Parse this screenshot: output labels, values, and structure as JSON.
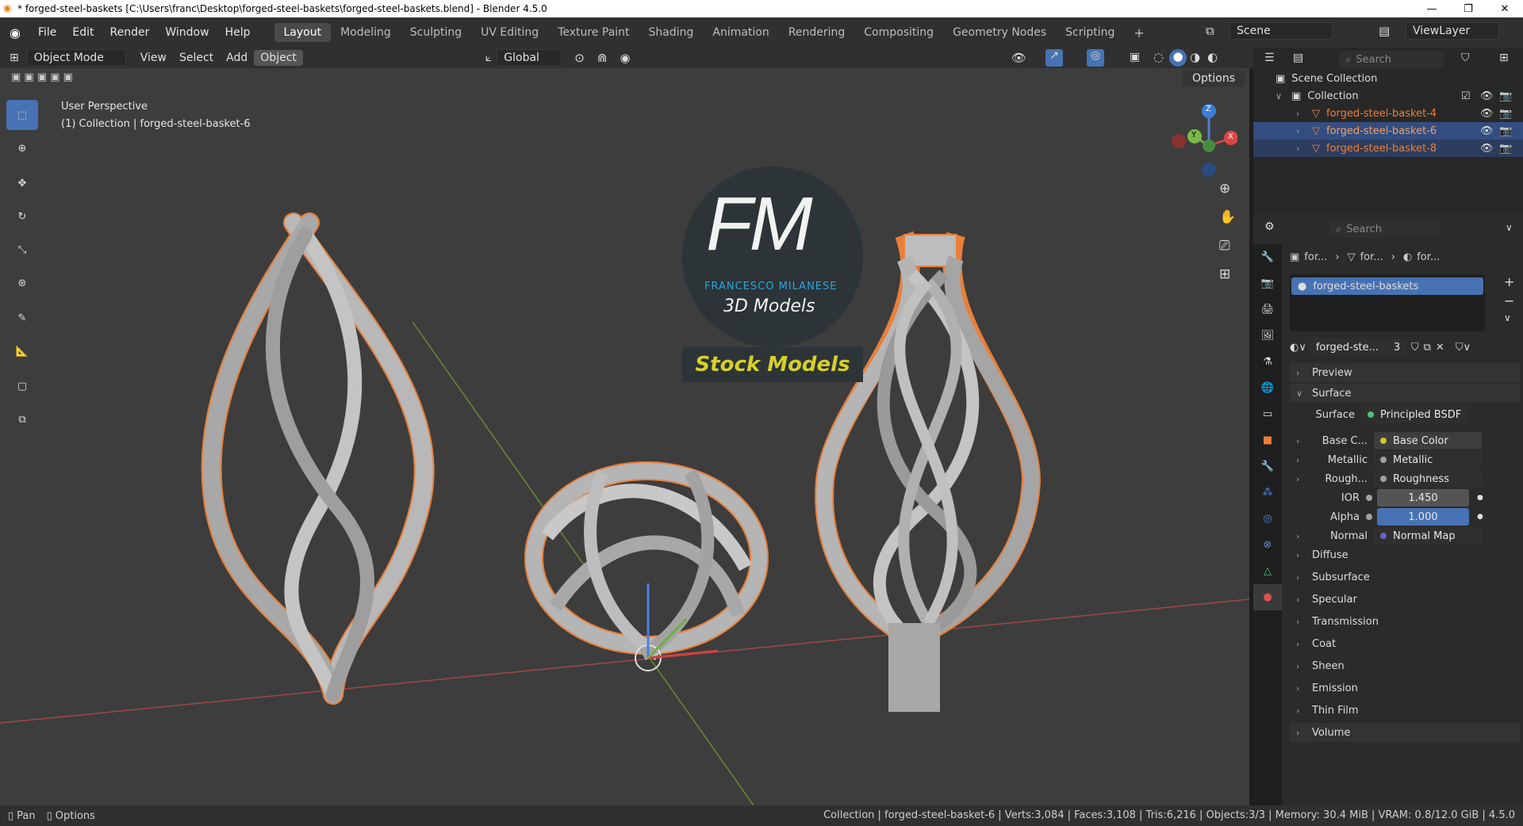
{
  "window": {
    "title": "* forged-steel-baskets [C:\\Users\\franc\\Desktop\\forged-steel-baskets\\forged-steel-baskets.blend] - Blender 4.5.0",
    "minimize": "—",
    "maximize": "❐",
    "close": "✕"
  },
  "menus": [
    "File",
    "Edit",
    "Render",
    "Window",
    "Help"
  ],
  "workspaces": [
    "Layout",
    "Modeling",
    "Sculpting",
    "UV Editing",
    "Texture Paint",
    "Shading",
    "Animation",
    "Rendering",
    "Compositing",
    "Geometry Nodes",
    "Scripting"
  ],
  "scene": {
    "label": "Scene",
    "viewlayer": "ViewLayer"
  },
  "viewport_header": {
    "mode": "Object Mode",
    "view": "View",
    "select": "Select",
    "add": "Add",
    "object": "Object",
    "orientation": "Global",
    "options": "Options"
  },
  "viewport": {
    "perspective": "User Perspective",
    "collection_info": "(1) Collection | forged-steel-basket-6"
  },
  "logo": {
    "letters": "FM",
    "name": "FRANCESCO MILANESE",
    "sub": "3D Models",
    "banner": "Stock Models"
  },
  "gizmo": {
    "z": "Z",
    "y": "Y",
    "x": "X"
  },
  "outliner": {
    "search": "Search",
    "root": "Scene Collection",
    "collection": "Collection",
    "items": [
      "forged-steel-basket-4",
      "forged-steel-basket-6",
      "forged-steel-basket-8"
    ]
  },
  "properties": {
    "search": "Search",
    "breadcrumb": [
      "for...",
      "for...",
      "for..."
    ],
    "material_slot": "forged-steel-baskets",
    "material_name": "forged-ste...",
    "user_count": "3",
    "sections": {
      "preview": "Preview",
      "surface": "Surface"
    },
    "surface_label": "Surface",
    "surface_value": "Principled BSDF",
    "inputs": [
      {
        "label": "Base C...",
        "value": "Base Color",
        "color": "#c7c729"
      },
      {
        "label": "Metallic",
        "value": "Metallic",
        "color": "#a1a1a1"
      },
      {
        "label": "Rough...",
        "value": "Roughness",
        "color": "#a1a1a1"
      }
    ],
    "ior": {
      "label": "IOR",
      "value": "1.450"
    },
    "alpha": {
      "label": "Alpha",
      "value": "1.000"
    },
    "normal": {
      "label": "Normal",
      "value": "Normal Map",
      "color": "#6363c7"
    },
    "subsections": [
      "Diffuse",
      "Subsurface",
      "Specular",
      "Transmission",
      "Coat",
      "Sheen",
      "Emission",
      "Thin Film",
      "Volume"
    ]
  },
  "status": {
    "pan": "Pan",
    "options": "Options",
    "info": "Collection | forged-steel-basket-6 | Verts:3,084 | Faces:3,108 | Tris:6,216 | Objects:3/3 | Memory: 30.4 MiB | VRAM: 0.8/12.0 GiB | 4.5.0"
  },
  "colors": {
    "accent": "#4772b3",
    "selection": "#e8803a",
    "logo_blue": "#29a8e0",
    "banner_text": "#d8d02a"
  }
}
